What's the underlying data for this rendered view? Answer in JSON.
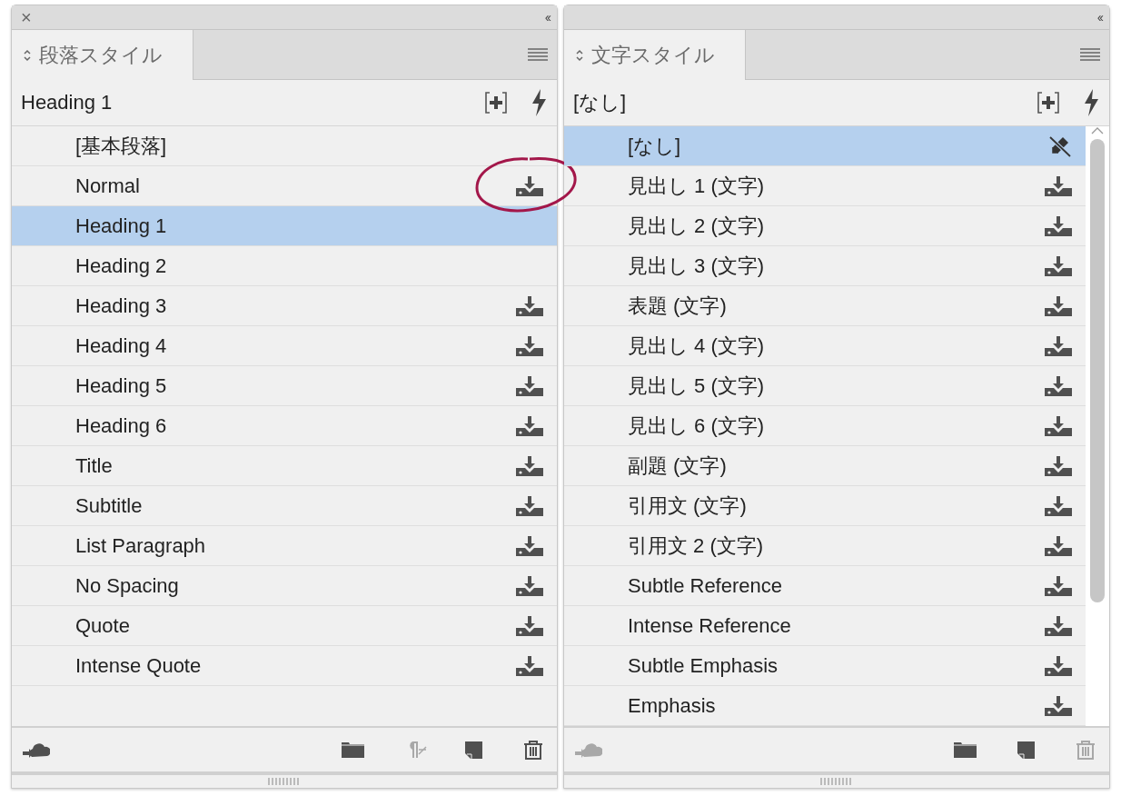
{
  "panels": [
    {
      "close": "×",
      "collapse": "‹‹",
      "tab": {
        "label": "段落スタイル",
        "selected": true
      },
      "current": "Heading 1",
      "rows": [
        {
          "label": "[基本段落]",
          "kind": "plain",
          "selected": false,
          "circled": false
        },
        {
          "label": "Normal",
          "kind": "imported",
          "selected": false,
          "circled": true
        },
        {
          "label": "Heading 1",
          "kind": "plain",
          "selected": true,
          "circled": false
        },
        {
          "label": "Heading 2",
          "kind": "plain",
          "selected": false,
          "circled": false
        },
        {
          "label": "Heading 3",
          "kind": "imported",
          "selected": false,
          "circled": false
        },
        {
          "label": "Heading 4",
          "kind": "imported",
          "selected": false,
          "circled": false
        },
        {
          "label": "Heading 5",
          "kind": "imported",
          "selected": false,
          "circled": false
        },
        {
          "label": "Heading 6",
          "kind": "imported",
          "selected": false,
          "circled": false
        },
        {
          "label": "Title",
          "kind": "imported",
          "selected": false,
          "circled": false
        },
        {
          "label": "Subtitle",
          "kind": "imported",
          "selected": false,
          "circled": false
        },
        {
          "label": "List Paragraph",
          "kind": "imported",
          "selected": false,
          "circled": false
        },
        {
          "label": "No Spacing",
          "kind": "imported",
          "selected": false,
          "circled": false
        },
        {
          "label": "Quote",
          "kind": "imported",
          "selected": false,
          "circled": false
        },
        {
          "label": "Intense Quote",
          "kind": "imported",
          "selected": false,
          "circled": false
        }
      ],
      "footer": [
        {
          "kind": "cloud",
          "disabled": false
        },
        {
          "kind": "folder",
          "disabled": false
        },
        {
          "kind": "clear-overrides",
          "disabled": true
        },
        {
          "kind": "new",
          "disabled": false
        },
        {
          "kind": "trash",
          "disabled": false
        }
      ]
    },
    {
      "collapse": "‹‹",
      "tab": {
        "label": "文字スタイル",
        "selected": true
      },
      "current": "[なし]",
      "rows": [
        {
          "label": "[なし]",
          "kind": "none-style",
          "selected": true,
          "circled": false
        },
        {
          "label": "見出し 1 (文字)",
          "kind": "imported",
          "selected": false,
          "circled": false
        },
        {
          "label": "見出し 2 (文字)",
          "kind": "imported",
          "selected": false,
          "circled": false
        },
        {
          "label": "見出し 3 (文字)",
          "kind": "imported",
          "selected": false,
          "circled": false
        },
        {
          "label": "表題 (文字)",
          "kind": "imported",
          "selected": false,
          "circled": false
        },
        {
          "label": "見出し 4 (文字)",
          "kind": "imported",
          "selected": false,
          "circled": false
        },
        {
          "label": "見出し 5 (文字)",
          "kind": "imported",
          "selected": false,
          "circled": false
        },
        {
          "label": "見出し 6 (文字)",
          "kind": "imported",
          "selected": false,
          "circled": false
        },
        {
          "label": "副題 (文字)",
          "kind": "imported",
          "selected": false,
          "circled": false
        },
        {
          "label": "引用文 (文字)",
          "kind": "imported",
          "selected": false,
          "circled": false
        },
        {
          "label": "引用文 2 (文字)",
          "kind": "imported",
          "selected": false,
          "circled": false
        },
        {
          "label": "Subtle Reference",
          "kind": "imported",
          "selected": false,
          "circled": false
        },
        {
          "label": "Intense Reference",
          "kind": "imported",
          "selected": false,
          "circled": false
        },
        {
          "label": "Subtle Emphasis",
          "kind": "imported",
          "selected": false,
          "circled": false
        },
        {
          "label": "Emphasis",
          "kind": "imported",
          "selected": false,
          "circled": false
        }
      ],
      "footer": [
        {
          "kind": "cloud",
          "disabled": true
        },
        {
          "kind": "folder",
          "disabled": false
        },
        {
          "kind": "new",
          "disabled": false
        },
        {
          "kind": "trash",
          "disabled": true
        }
      ]
    }
  ]
}
